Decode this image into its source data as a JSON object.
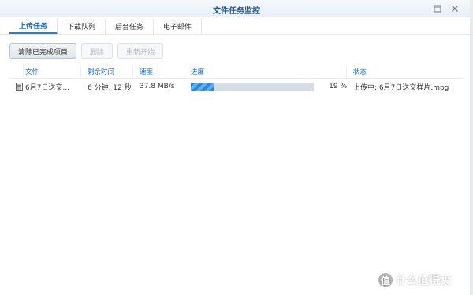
{
  "window": {
    "title": "文件任务监控"
  },
  "tabs": [
    {
      "label": "上传任务",
      "active": true
    },
    {
      "label": "下载队列",
      "active": false
    },
    {
      "label": "后台任务",
      "active": false
    },
    {
      "label": "电子邮件",
      "active": false
    }
  ],
  "toolbar": {
    "clear_label": "清除已完成项目",
    "delete_label": "删除",
    "restart_label": "重新开始"
  },
  "table": {
    "columns": [
      "文件",
      "剩余时间",
      "速度",
      "进度",
      "状态"
    ],
    "rows": [
      {
        "file": "6月7日送交...",
        "time_left": "6 分钟, 12 秒",
        "speed": "37.8 MB/s",
        "progress": 0.19,
        "progress_text": "19 %",
        "status": "上传中: 6月7日送交样片.mpg"
      }
    ]
  },
  "watermark": {
    "badge": "值",
    "text": "什么值得买"
  },
  "colors": {
    "accent": "#1c6ac0",
    "progress": "#2f86d6",
    "progress_track": "#d4dde5"
  },
  "icons": [
    "maximize-icon",
    "close-icon",
    "file-icon"
  ]
}
